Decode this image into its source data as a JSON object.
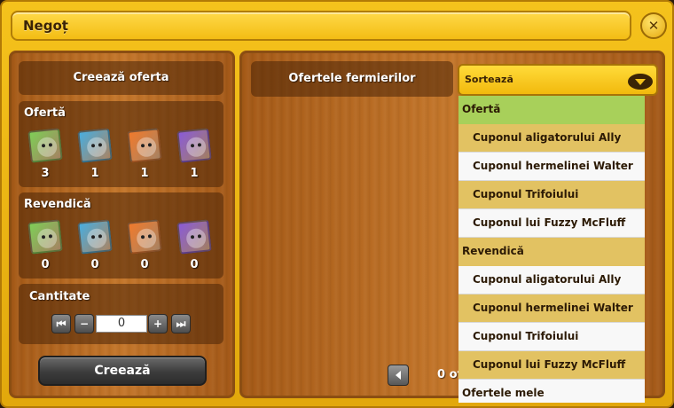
{
  "window": {
    "title": "Negoț",
    "close_icon": "close-icon"
  },
  "left": {
    "create_header": "Creează oferta",
    "offer": {
      "label": "Ofertă",
      "coupons": [
        {
          "icon": "alligator-coupon-icon",
          "color": "#7fcf58",
          "count": "3"
        },
        {
          "icon": "ermine-coupon-icon",
          "color": "#49aee0",
          "count": "1"
        },
        {
          "icon": "rabbit-coupon-icon",
          "color": "#f07a2c",
          "count": "1"
        },
        {
          "icon": "cat-coupon-icon",
          "color": "#8a5bd8",
          "count": "1"
        }
      ]
    },
    "claim": {
      "label": "Revendică",
      "coupons": [
        {
          "icon": "alligator-coupon-icon",
          "color": "#7fcf58",
          "count": "0"
        },
        {
          "icon": "ermine-coupon-icon",
          "color": "#49aee0",
          "count": "0"
        },
        {
          "icon": "rabbit-coupon-icon",
          "color": "#f07a2c",
          "count": "0"
        },
        {
          "icon": "cat-coupon-icon",
          "color": "#8a5bd8",
          "count": "0"
        }
      ]
    },
    "quantity": {
      "label": "Cantitate",
      "value": "0"
    },
    "create_button": "Creează"
  },
  "right": {
    "header": "Ofertele fermierilor",
    "sort_label": "Sortează",
    "pagination": "0 of",
    "dropdown": [
      {
        "label": "Ofertă",
        "kind": "header",
        "bg": "#a8d05a"
      },
      {
        "label": "Cuponul aligatorului Ally",
        "kind": "option",
        "bg": "#e2c262"
      },
      {
        "label": "Cuponul hermelinei Walter",
        "kind": "option",
        "bg": "#f8f8f8"
      },
      {
        "label": "Cuponul Trifoiului",
        "kind": "option",
        "bg": "#e2c262"
      },
      {
        "label": "Cuponul lui Fuzzy McFluff",
        "kind": "option",
        "bg": "#f8f8f8"
      },
      {
        "label": "Revendică",
        "kind": "header",
        "bg": "#e2c262"
      },
      {
        "label": "Cuponul aligatorului Ally",
        "kind": "option",
        "bg": "#f8f8f8"
      },
      {
        "label": "Cuponul hermelinei Walter",
        "kind": "option",
        "bg": "#e2c262"
      },
      {
        "label": "Cuponul Trifoiului",
        "kind": "option",
        "bg": "#f8f8f8"
      },
      {
        "label": "Cuponul lui Fuzzy McFluff",
        "kind": "option",
        "bg": "#e2c262"
      },
      {
        "label": "Ofertele mele",
        "kind": "header",
        "bg": "#f8f8f8"
      }
    ]
  }
}
